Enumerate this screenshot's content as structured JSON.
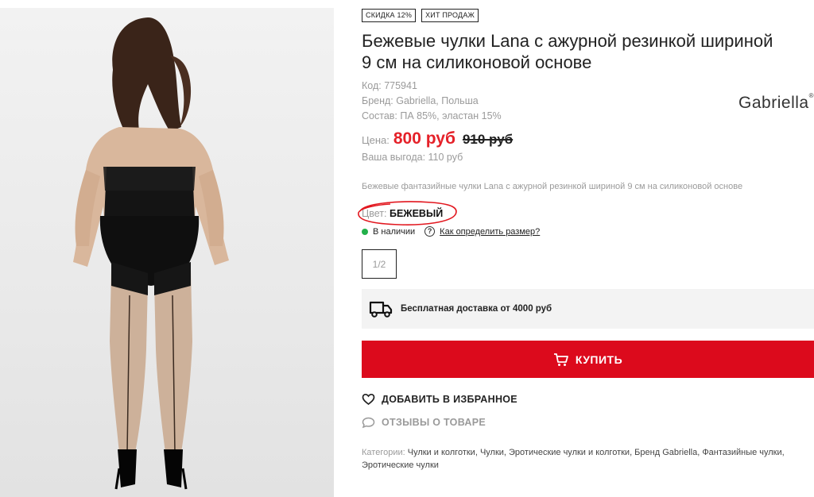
{
  "product_image": {
    "alt": "product-photo"
  },
  "badges": [
    "СКИДКА 12%",
    "ХИТ ПРОДАЖ"
  ],
  "title": "Бежевые чулки Lana с ажурной резинкой шириной 9 см на силиконовой основе",
  "meta": {
    "code": "Код: 775941",
    "brand": "Бренд: Gabriella, Польша",
    "composition": "Состав: ПА 85%, эластан 15%"
  },
  "brand_logo": {
    "text": "Gabriella",
    "mark": "®"
  },
  "price": {
    "label": "Цена:",
    "current": "800 руб",
    "old": "910 руб",
    "benefit": "Ваша выгода: 110 руб"
  },
  "description": "Бежевые фантазийные чулки Lana с ажурной резинкой шириной 9 см на силиконовой основе",
  "color": {
    "label": "Цвет:",
    "value": "БЕЖЕВЫЙ"
  },
  "stock": {
    "status": "В наличии",
    "size_help": "Как определить размер?"
  },
  "sizes": [
    "1/2"
  ],
  "delivery": {
    "text": "Бесплатная доставка от 4000 руб"
  },
  "buy_button": {
    "label": "КУПИТЬ"
  },
  "favorite": {
    "label": "ДОБАВИТЬ В ИЗБРАННОЕ"
  },
  "reviews": {
    "label": "ОТЗЫВЫ О ТОВАРЕ"
  },
  "categories": {
    "label": "Категории:",
    "list": "Чулки и колготки, Чулки, Эротические чулки и колготки, Бренд Gabriella, Фантазийные чулки, Эротические чулки"
  },
  "colors": {
    "accent": "#dc0a1c",
    "price": "#e52129",
    "in_stock": "#22b04a",
    "muted": "#9a9a9a"
  }
}
